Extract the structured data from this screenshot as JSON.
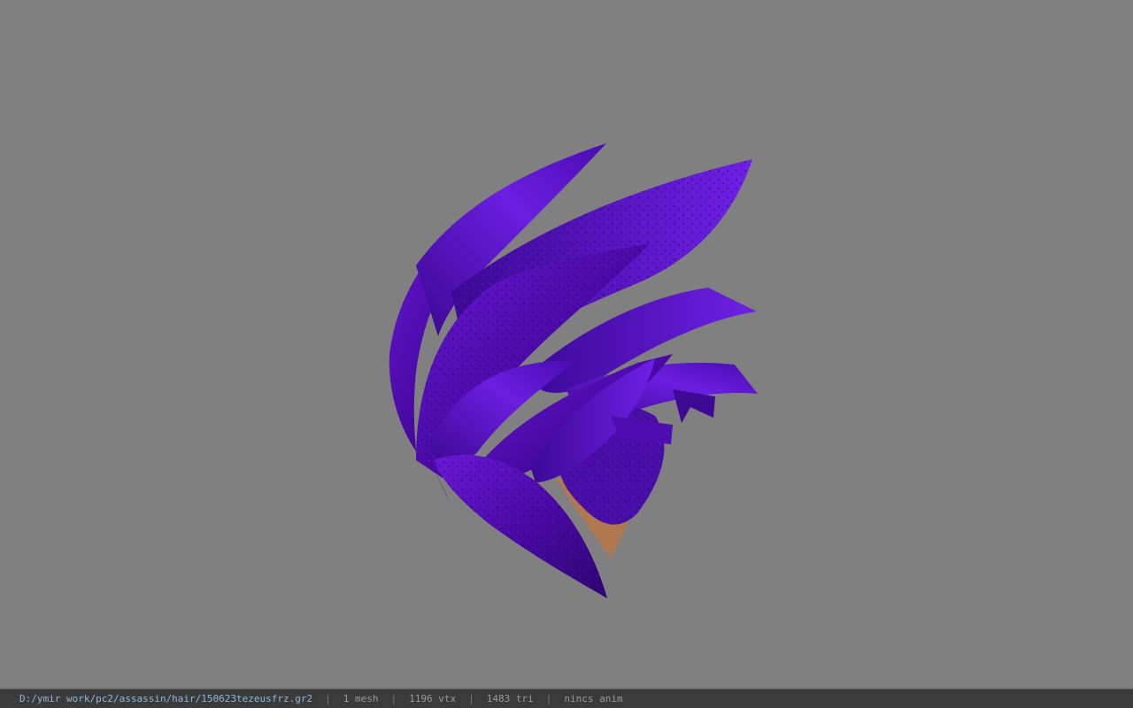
{
  "viewer": {
    "background_color": "#808080",
    "model": {
      "name": "hair-mesh",
      "base_color": "#5a10c0"
    }
  },
  "status_bar": {
    "file_path": "D:/ymir work/pc2/assassin/hair/150623tezeusfrz.gr2",
    "mesh_count": "1 mesh",
    "vertex_count": "1196 vtx",
    "triangle_count": "1483 tri",
    "anim_status": "nincs anim",
    "separator": "|"
  }
}
